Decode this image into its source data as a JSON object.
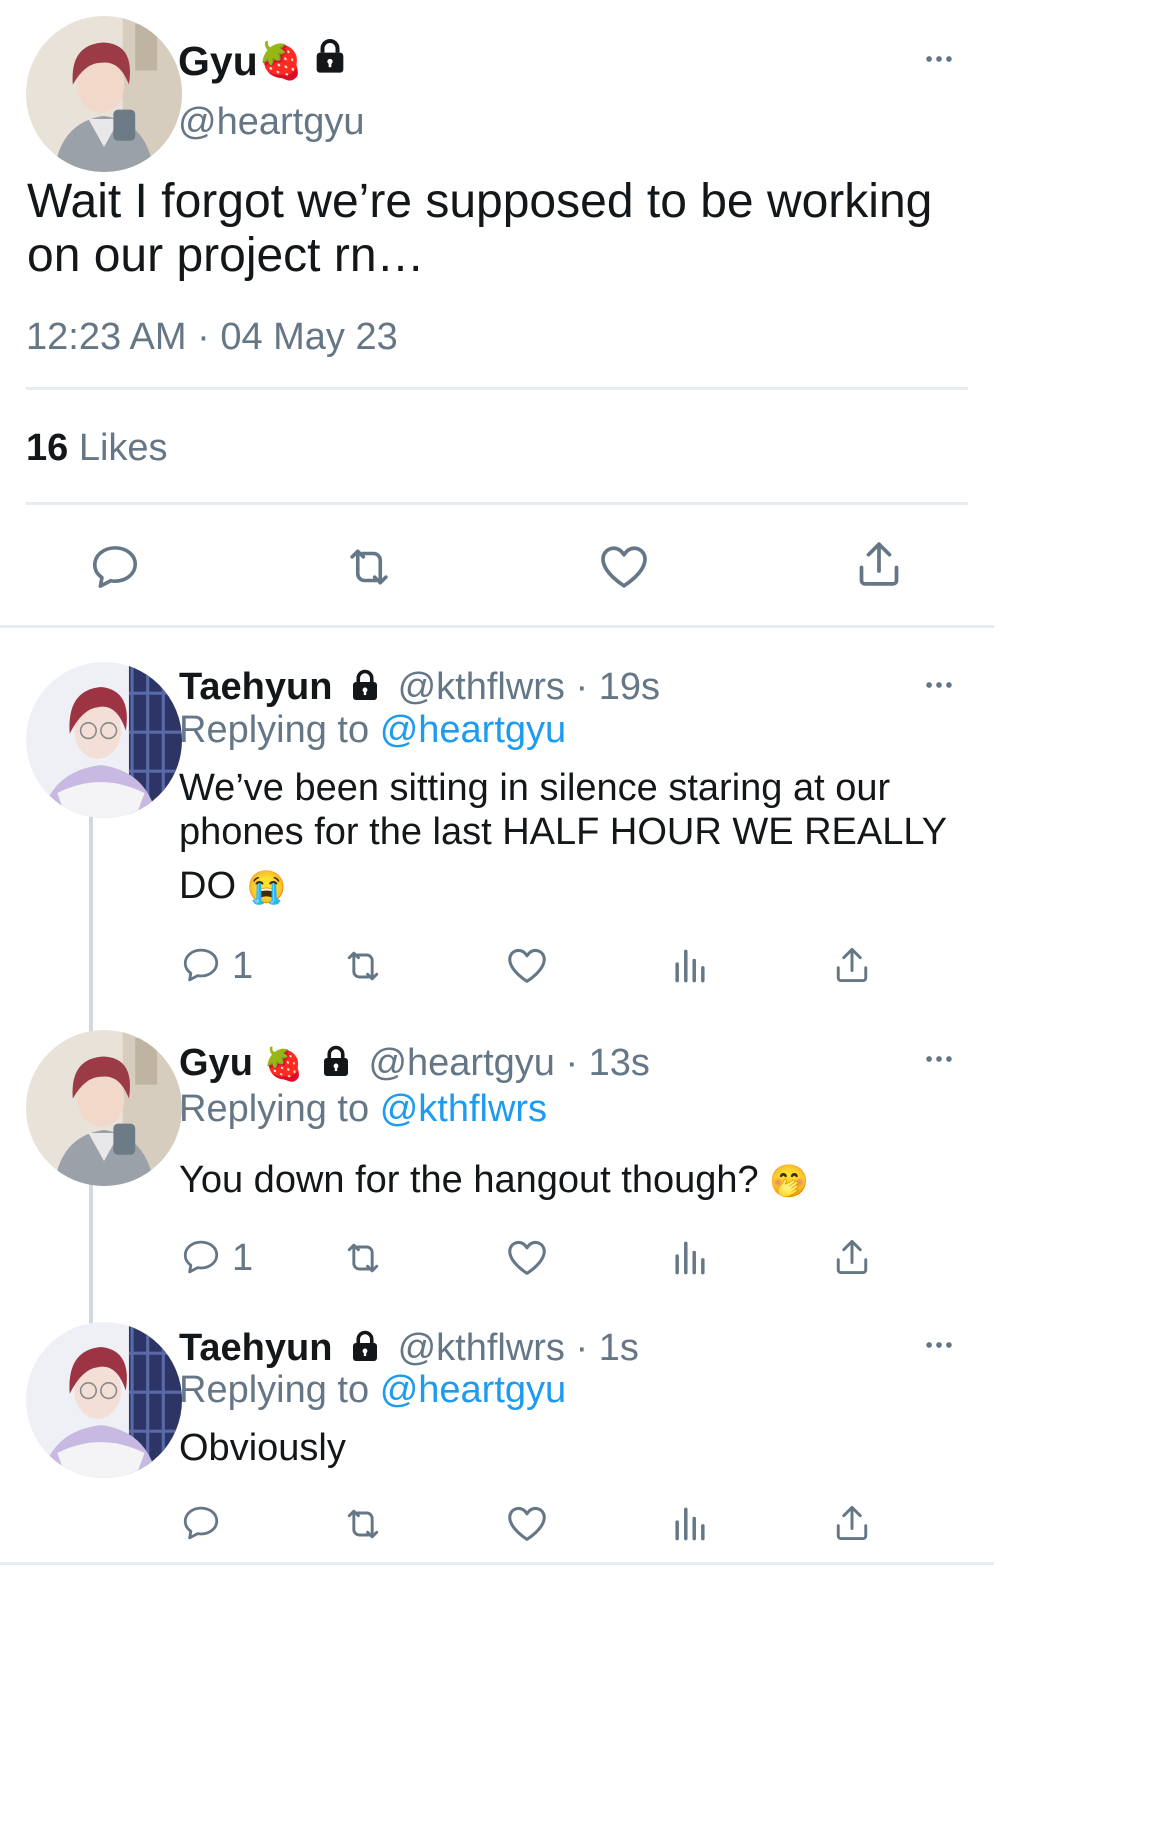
{
  "colors": {
    "accent": "#1d9bf0",
    "text": "#14171a",
    "secondary": "#657786",
    "divider": "#e6ecf0"
  },
  "main_tweet": {
    "display_name": "Gyu",
    "name_emoji": "🍓",
    "handle": "@heartgyu",
    "text_line1": "Wait I forgot we’re supposed to be working",
    "text_line2": "on our project rn…",
    "timestamp": "12:23 AM · 04 May 23",
    "likes_count": "16",
    "likes_label": "Likes",
    "more_icon": "more-horizontal-icon",
    "lock_icon": "lock-icon"
  },
  "replies": [
    {
      "display_name": "Taehyun",
      "meta": "@kthflwrs · 19s",
      "replying_prefix": "Replying to",
      "replying_handle": "@heartgyu",
      "text_line1": "We’ve been sitting in silence staring at our",
      "text_line2": "phones for the last HALF HOUR WE REALLY",
      "text_line3": "DO",
      "emoji": "😭",
      "reply_count": "1"
    },
    {
      "display_name": "Gyu",
      "name_emoji": "🍓",
      "meta": "@heartgyu · 13s",
      "replying_prefix": "Replying to",
      "replying_handle": "@kthflwrs",
      "text_line1": "You down for the hangout though?",
      "emoji": "🤭",
      "reply_count": "1"
    },
    {
      "display_name": "Taehyun",
      "meta": "@kthflwrs · 1s",
      "replying_prefix": "Replying to",
      "replying_handle": "@heartgyu",
      "text_line1": "Obviously",
      "reply_count": ""
    }
  ]
}
